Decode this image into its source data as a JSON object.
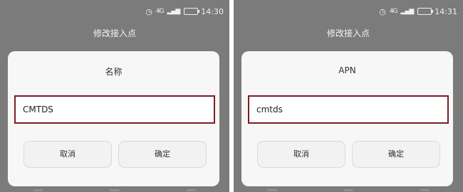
{
  "screens": [
    {
      "status": {
        "icons": [
          "alarm-icon",
          "signal-icon",
          "battery-icon"
        ],
        "network": "4G",
        "time": "14:30"
      },
      "header_title": "修改接入点",
      "dialog": {
        "title": "名称",
        "input_value": "CMTDS",
        "cancel_label": "取消",
        "confirm_label": "确定"
      }
    },
    {
      "status": {
        "icons": [
          "alarm-icon",
          "signal-icon",
          "battery-icon"
        ],
        "network": "4G",
        "time": "14:31"
      },
      "header_title": "修改接入点",
      "dialog": {
        "title": "APN",
        "input_value": "cmtds",
        "cancel_label": "取消",
        "confirm_label": "确定"
      }
    }
  ],
  "colors": {
    "background_dim": "#7b7b7b",
    "dialog_bg": "#f7f7f7",
    "input_border": "#7a1e22"
  }
}
